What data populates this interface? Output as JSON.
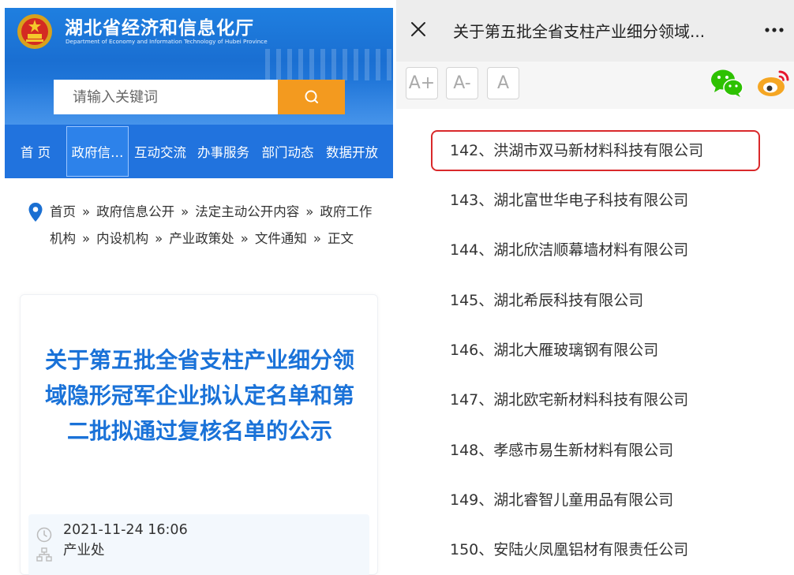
{
  "site": {
    "title": "湖北省经济和信息化厅",
    "subtitle": "Department of Economy and Information Technology of Hubei Province",
    "search_placeholder": "请输入关键词"
  },
  "nav": {
    "items": [
      "首 页",
      "政府信…",
      "互动交流",
      "办事服务",
      "部门动态",
      "数据开放"
    ],
    "active_index": 1
  },
  "breadcrumb": {
    "items": [
      "首页",
      "政府信息公开",
      "法定主动公开内容",
      "政府工作机构",
      "内设机构",
      "产业政策处",
      "文件通知",
      "正文"
    ],
    "separator": "»"
  },
  "article": {
    "title": "关于第五批全省支柱产业细分领域隐形冠军企业拟认定名单和第二批拟通过复核名单的公示",
    "date": "2021-11-24 16:06",
    "department": "产业处"
  },
  "right": {
    "doc_title": "关于第五批全省支柱产业细分领域...",
    "font_buttons": [
      "A+",
      "A-",
      "A"
    ],
    "companies": [
      "142、洪湖市双马新材料科技有限公司",
      "143、湖北富世华电子科技有限公司",
      "144、湖北欣洁顺幕墙材料有限公司",
      "145、湖北希辰科技有限公司",
      "146、湖北大雁玻璃钢有限公司",
      "147、湖北欧宅新材料科技有限公司",
      "148、孝感市易生新材料有限公司",
      "149、湖北睿智儿童用品有限公司",
      "150、安陆火凤凰铝材有限责任公司"
    ],
    "highlighted_index": 0
  },
  "colors": {
    "banner_blue": "#1f7fe0",
    "nav_blue": "#2173de",
    "search_orange": "#f39a1f",
    "title_blue": "#1a72d8",
    "highlight_red": "#d9292b",
    "wechat_green": "#2dc100",
    "weibo_orange": "#f5a623"
  },
  "icons": {
    "emblem": "national-emblem-icon",
    "search": "search-icon",
    "location": "location-pin-icon",
    "clock": "clock-icon",
    "department": "org-chart-icon",
    "close": "close-icon",
    "more": "more-dots-icon",
    "wechat": "wechat-icon",
    "weibo": "weibo-icon"
  }
}
